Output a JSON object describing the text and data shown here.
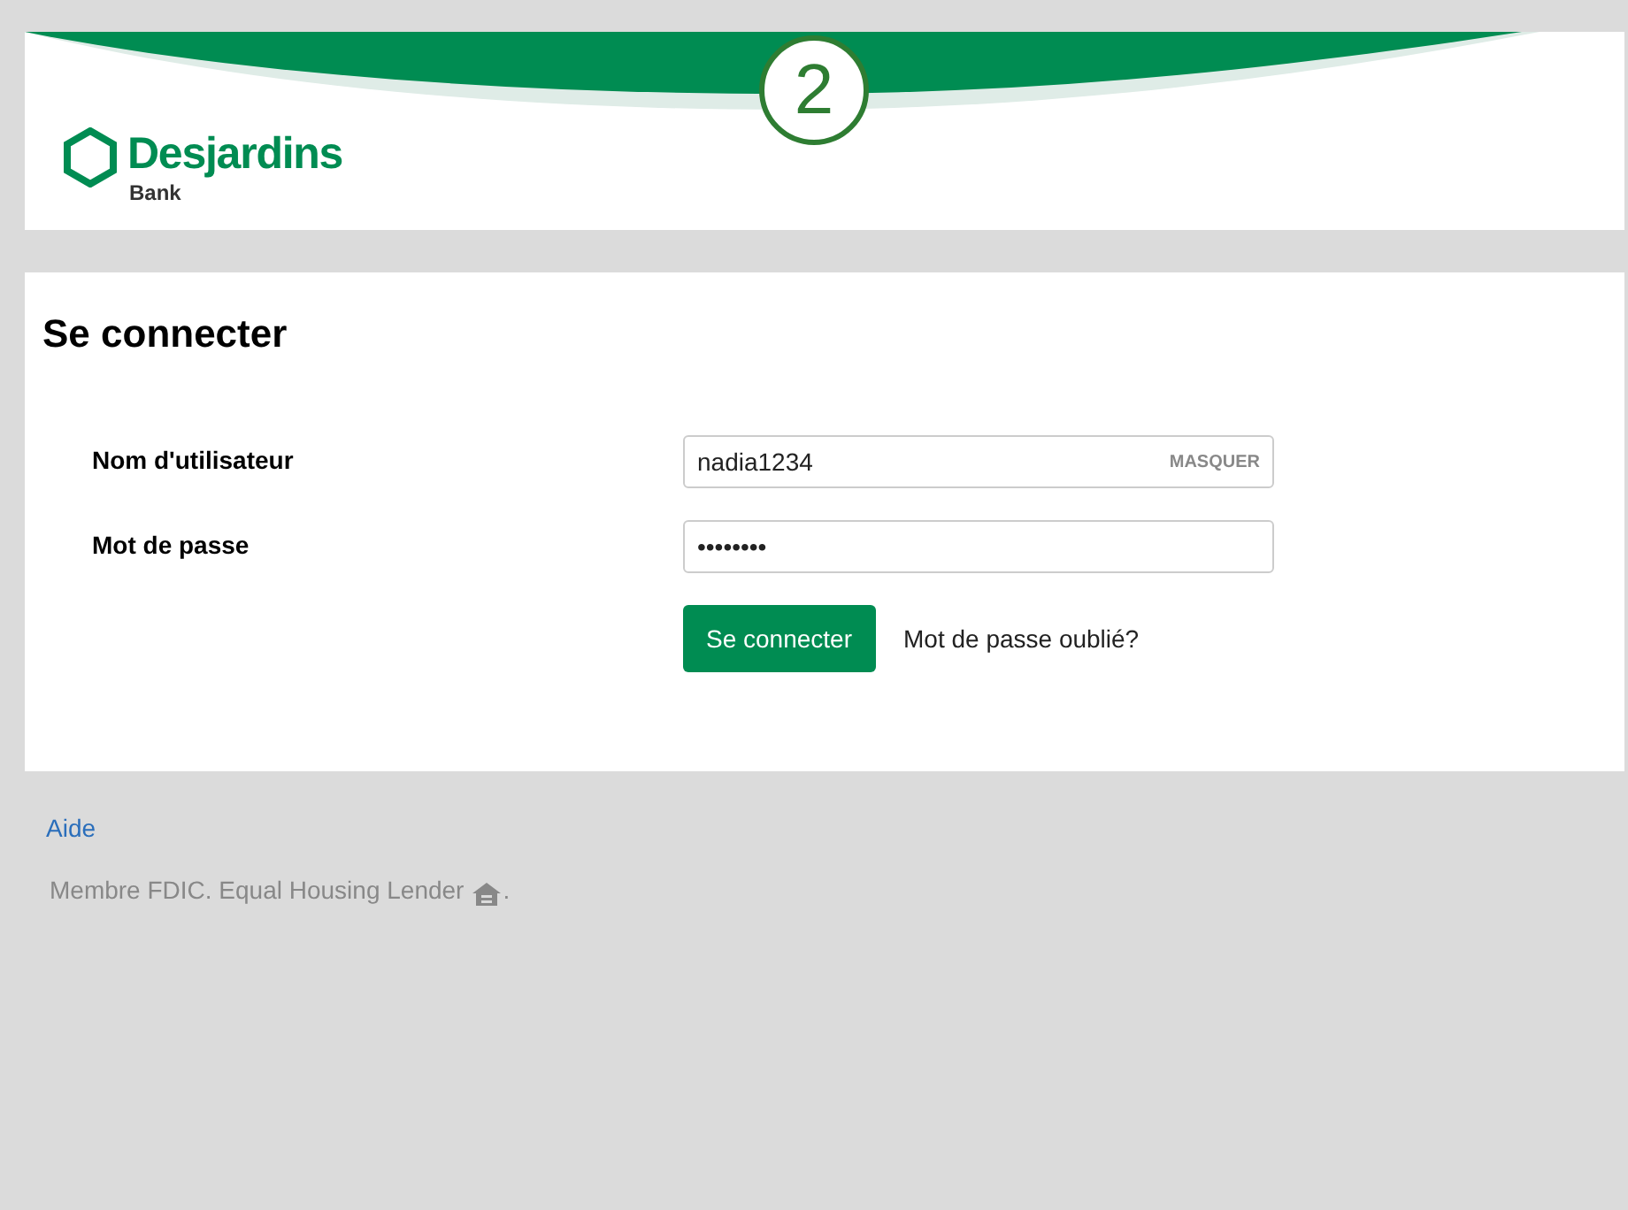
{
  "header": {
    "step": "2",
    "logo": {
      "name": "Desjardins",
      "subtitle": "Bank"
    }
  },
  "login": {
    "title": "Se connecter",
    "fields": [
      {
        "label": "Nom d'utilisateur",
        "value": "nadia1234",
        "action": "MASQUER"
      },
      {
        "label": "Mot de passe",
        "value": "••••••••"
      }
    ],
    "submit": "Se connecter",
    "forgot_link": "Mot de passe oublié?"
  },
  "footer": {
    "help_link": "Aide",
    "notice": "Membre FDIC. Equal Housing Lender",
    "notice_end": "."
  }
}
